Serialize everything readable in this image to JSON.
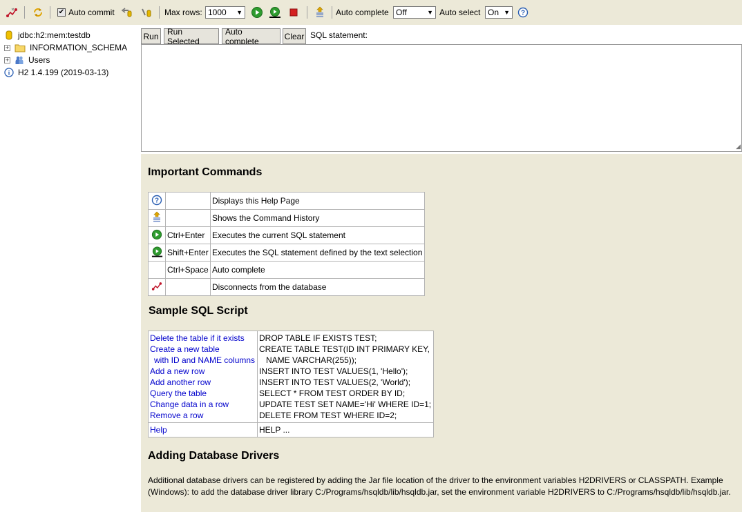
{
  "toolbar": {
    "auto_commit_label": "Auto commit",
    "max_rows_label": "Max rows:",
    "max_rows_value": "1000",
    "auto_complete_label": "Auto complete",
    "auto_complete_value": "Off",
    "auto_select_label": "Auto select",
    "auto_select_value": "On",
    "icons": [
      "disconnect-icon",
      "refresh-icon",
      "rollback-icon",
      "commit-icon",
      "run-icon",
      "run-selected-icon",
      "stop-icon",
      "history-icon",
      "help-icon"
    ]
  },
  "sidebar": {
    "connection": "jdbc:h2:mem:testdb",
    "schema": "INFORMATION_SCHEMA",
    "users": "Users",
    "version": "H2 1.4.199 (2019-03-13)"
  },
  "query": {
    "run": "Run",
    "run_selected": "Run Selected",
    "auto_complete": "Auto complete",
    "clear": "Clear",
    "sql_label": "SQL statement:",
    "sql_value": ""
  },
  "help": {
    "commands_title": "Important Commands",
    "commands": [
      {
        "key": "",
        "desc": "Displays this Help Page",
        "icon": "help-icon"
      },
      {
        "key": "",
        "desc": "Shows the Command History",
        "icon": "history-icon"
      },
      {
        "key": "Ctrl+Enter",
        "desc": "Executes the current SQL statement",
        "icon": "run-icon"
      },
      {
        "key": "Shift+Enter",
        "desc": "Executes the SQL statement defined by the text selection",
        "icon": "run-selected-icon"
      },
      {
        "key": "Ctrl+Space",
        "desc": "Auto complete",
        "icon": ""
      },
      {
        "key": "",
        "desc": "Disconnects from the database",
        "icon": "disconnect-icon"
      }
    ],
    "sample_title": "Sample SQL Script",
    "sample_links": [
      "Delete the table if it exists",
      "Create a new table",
      "with ID and NAME columns",
      "Add a new row",
      "Add another row",
      "Query the table",
      "Change data in a row",
      "Remove a row"
    ],
    "sample_sql": [
      "DROP TABLE IF EXISTS TEST;",
      "CREATE TABLE TEST(ID INT PRIMARY KEY,",
      "NAME VARCHAR(255));",
      "INSERT INTO TEST VALUES(1, 'Hello');",
      "INSERT INTO TEST VALUES(2, 'World');",
      "SELECT * FROM TEST ORDER BY ID;",
      "UPDATE TEST SET NAME='Hi' WHERE ID=1;",
      "DELETE FROM TEST WHERE ID=2;"
    ],
    "help_link": "Help",
    "help_sql": "HELP ...",
    "drivers_title": "Adding Database Drivers",
    "drivers_text": "Additional database drivers can be registered by adding the Jar file location of the driver to the environment variables H2DRIVERS or CLASSPATH. Example (Windows): to add the database driver library C:/Programs/hsqldb/lib/hsqldb.jar, set the environment variable H2DRIVERS to C:/Programs/hsqldb/lib/hsqldb.jar."
  }
}
